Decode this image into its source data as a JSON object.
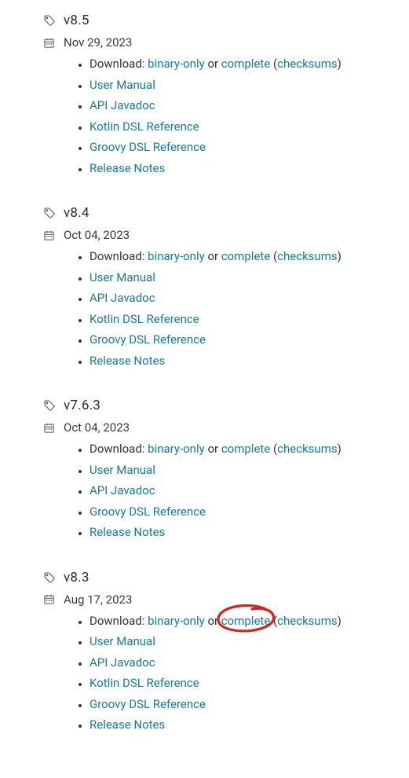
{
  "download_label": "Download:",
  "binary_only": "binary-only",
  "or_word": "or",
  "complete_word": "complete",
  "checksums_word": "checksums",
  "releases": [
    {
      "version": "v8.5",
      "date": "Nov 29, 2023",
      "links": [
        "User Manual",
        "API Javadoc",
        "Kotlin DSL Reference",
        "Groovy DSL Reference",
        "Release Notes"
      ],
      "circled": false
    },
    {
      "version": "v8.4",
      "date": "Oct 04, 2023",
      "links": [
        "User Manual",
        "API Javadoc",
        "Kotlin DSL Reference",
        "Groovy DSL Reference",
        "Release Notes"
      ],
      "circled": false
    },
    {
      "version": "v7.6.3",
      "date": "Oct 04, 2023",
      "links": [
        "User Manual",
        "API Javadoc",
        "Groovy DSL Reference",
        "Release Notes"
      ],
      "circled": false
    },
    {
      "version": "v8.3",
      "date": "Aug 17, 2023",
      "links": [
        "User Manual",
        "API Javadoc",
        "Kotlin DSL Reference",
        "Groovy DSL Reference",
        "Release Notes"
      ],
      "circled": true
    }
  ]
}
